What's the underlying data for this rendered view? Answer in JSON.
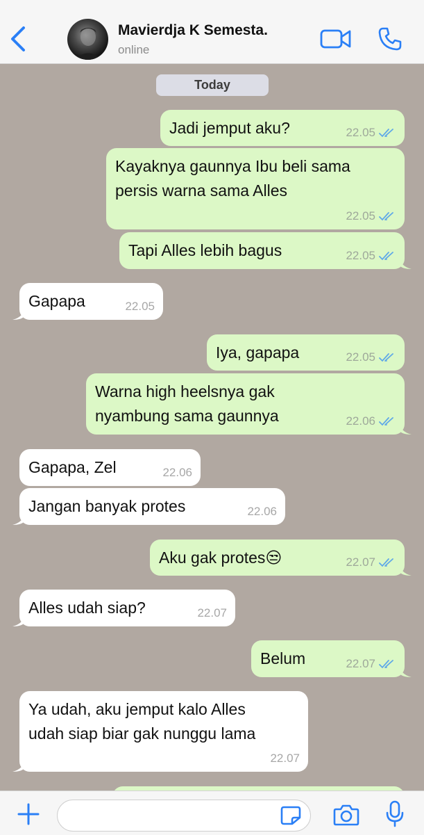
{
  "header": {
    "contact_name": "Mavierdja K Semesta.",
    "status": "online"
  },
  "chat": {
    "date_label": "Today",
    "messages": [
      {
        "dir": "out",
        "text": "Jadi jemput aku?",
        "time": "22.05"
      },
      {
        "dir": "out",
        "text": "Kayaknya gaunnya Ibu beli sama\npersis warna sama Alles",
        "time": "22.05"
      },
      {
        "dir": "out",
        "text": "Tapi Alles lebih bagus",
        "time": "22.05"
      },
      {
        "dir": "in",
        "text": "Gapapa",
        "time": "22.05"
      },
      {
        "dir": "out",
        "text": "Iya, gapapa",
        "time": "22.05"
      },
      {
        "dir": "out",
        "text": "Warna high heelsnya gak\nnyambung sama gaunnya",
        "time": "22.06"
      },
      {
        "dir": "in",
        "text": "Gapapa, Zel",
        "time": "22.06"
      },
      {
        "dir": "in",
        "text": "Jangan banyak protes",
        "time": "22.06"
      },
      {
        "dir": "out",
        "text": "Aku gak protes😒",
        "time": "22.07"
      },
      {
        "dir": "in",
        "text": "Alles udah siap?",
        "time": "22.07"
      },
      {
        "dir": "out",
        "text": "Belum",
        "time": "22.07"
      },
      {
        "dir": "in",
        "text": "Ya udah, aku jemput kalo Alles\nudah siap biar gak nunggu lama",
        "time": "22.07"
      }
    ]
  },
  "composer": {
    "placeholder": ""
  },
  "colors": {
    "accent": "#2a7ff6",
    "outgoing_bubble": "#dcf8c6",
    "incoming_bubble": "#ffffff",
    "chat_background": "#b1a8a1",
    "read_ticks": "#5fa8e8"
  },
  "icons": [
    "back-chevron-icon",
    "video-camera-icon",
    "phone-icon",
    "plus-icon",
    "sticker-icon",
    "camera-icon",
    "microphone-icon",
    "double-check-icon"
  ]
}
